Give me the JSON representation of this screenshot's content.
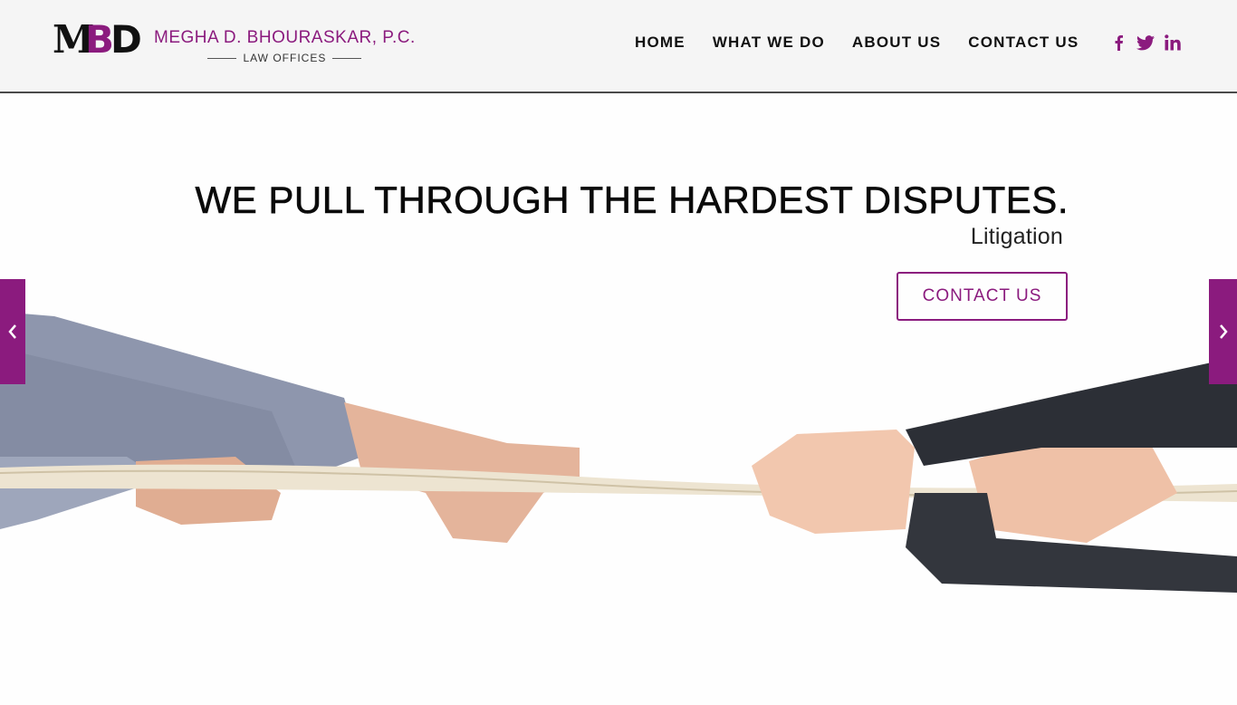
{
  "brand": {
    "name": "MEGHA D. BHOURASKAR, P.C.",
    "tagline": "LAW OFFICES",
    "mark_m": "M",
    "mark_b": "B",
    "mark_d": "D"
  },
  "nav": {
    "items": [
      {
        "label": "HOME"
      },
      {
        "label": "WHAT WE DO"
      },
      {
        "label": "ABOUT US"
      },
      {
        "label": "CONTACT US"
      }
    ]
  },
  "social": {
    "icons": [
      "facebook-icon",
      "twitter-icon",
      "linkedin-icon"
    ]
  },
  "hero": {
    "headline": "WE PULL THROUGH THE HARDEST DISPUTES.",
    "subline": "Litigation",
    "cta_label": "CONTACT US"
  },
  "colors": {
    "accent": "#8b1b7e",
    "header_bg": "#f5f5f5",
    "text": "#111111"
  }
}
